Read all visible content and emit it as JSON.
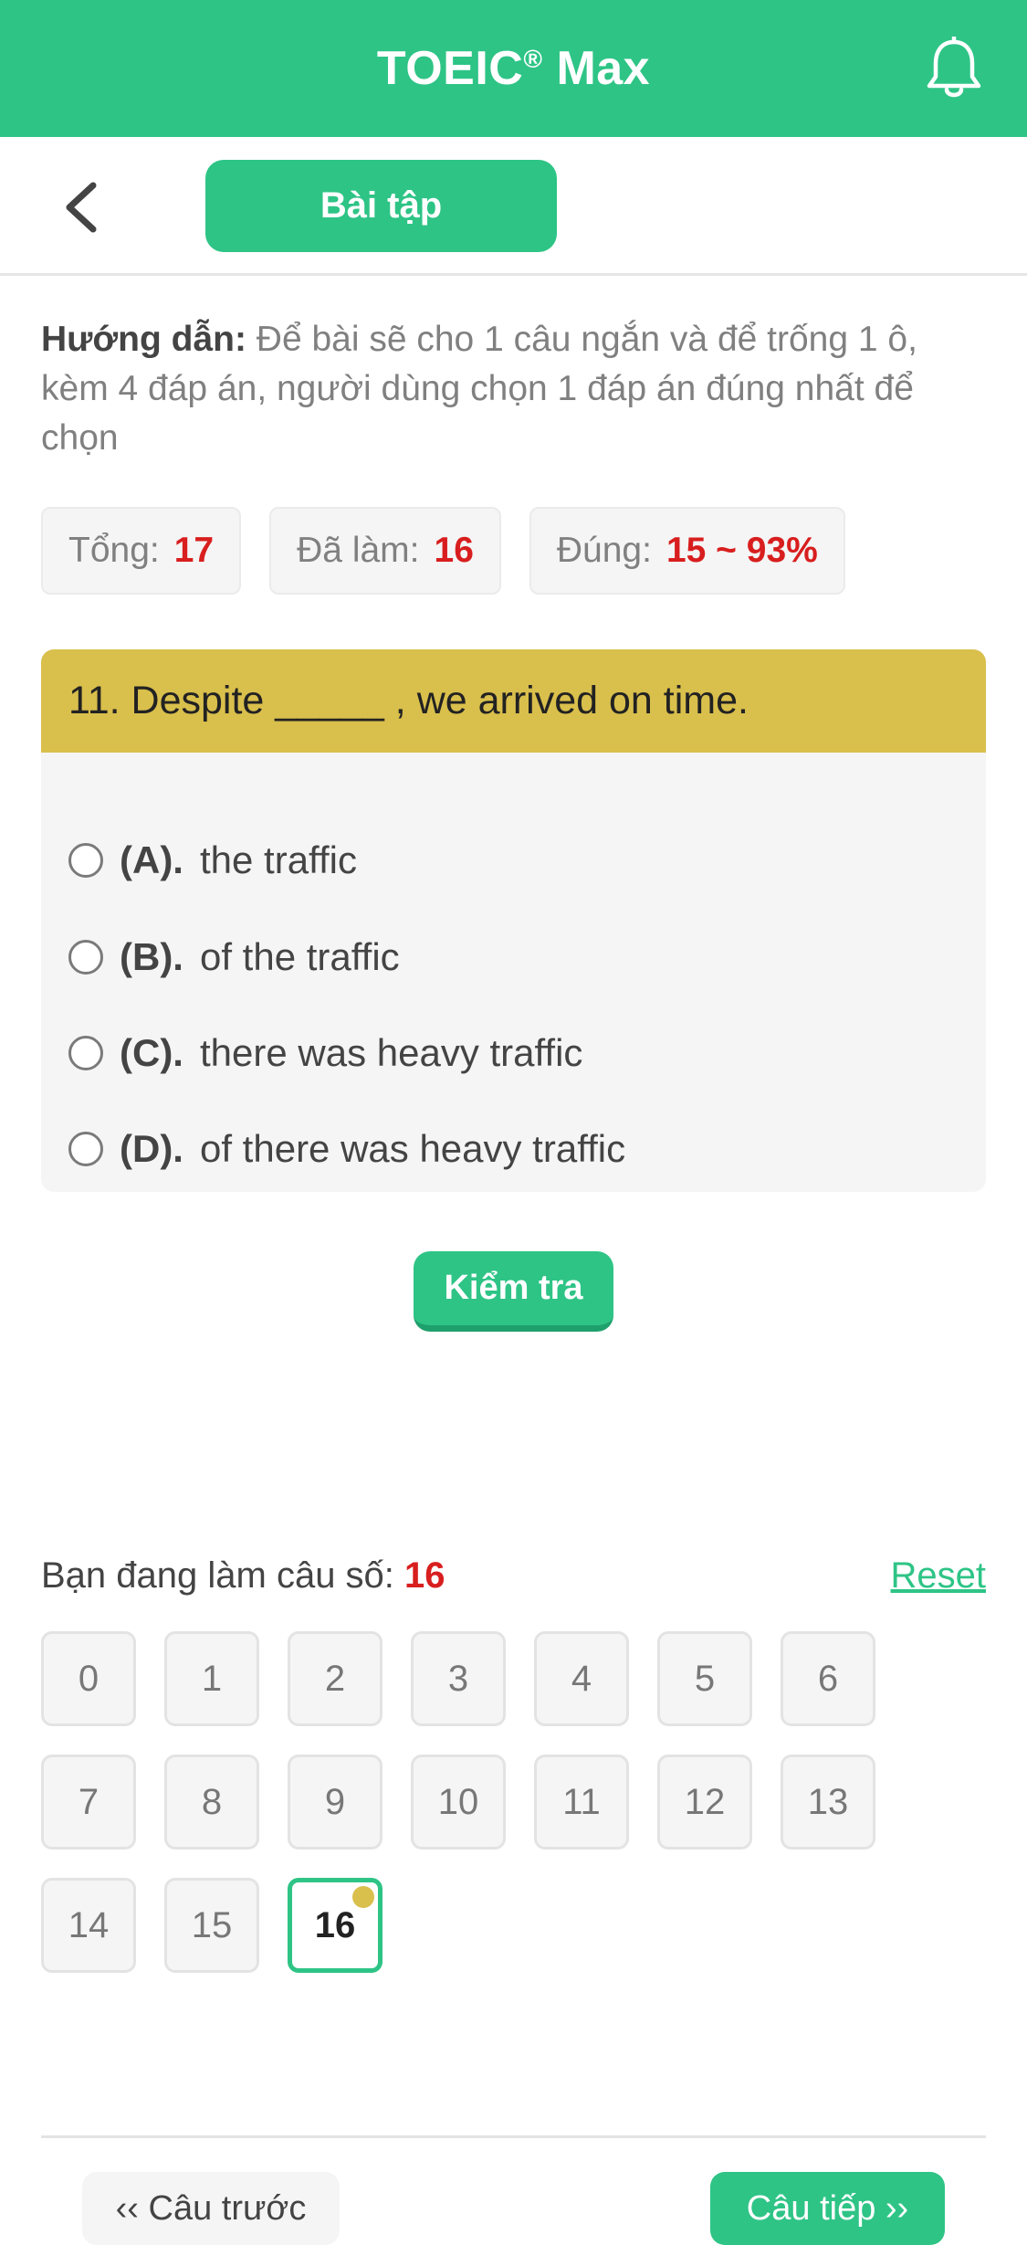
{
  "header": {
    "title_main": "TOEIC",
    "title_reg": "®",
    "title_suffix": " Max",
    "bell_icon": "bell-icon"
  },
  "subbar": {
    "back_icon": "chevron-left-icon",
    "tab_label": "Bài tập"
  },
  "guide": {
    "label": "Hướng dẫn:",
    "text": " Để bài sẽ cho 1 câu ngắn và để trống 1 ô, kèm 4 đáp án, người dùng chọn 1 đáp án đúng nhất để chọn"
  },
  "stats": [
    {
      "label": "Tổng:",
      "value": "17"
    },
    {
      "label": "Đã làm:",
      "value": "16"
    },
    {
      "label": "Đúng:",
      "value": "15 ~ 93%"
    }
  ],
  "question": {
    "text": "11. Despite _____ , we arrived on time.",
    "options": [
      {
        "label": "(A).",
        "text": "the traffic"
      },
      {
        "label": "(B).",
        "text": "of the traffic"
      },
      {
        "label": "(C).",
        "text": "there was heavy traffic"
      },
      {
        "label": "(D).",
        "text": "of there was heavy traffic"
      }
    ]
  },
  "check_button": "Kiểm tra",
  "progress": {
    "label": "Bạn đang làm câu số:",
    "current": "16",
    "reset": "Reset"
  },
  "grid": {
    "items": [
      "0",
      "1",
      "2",
      "3",
      "4",
      "5",
      "6",
      "7",
      "8",
      "9",
      "10",
      "11",
      "12",
      "13",
      "14",
      "15",
      "16"
    ],
    "active_index": 16
  },
  "nav": {
    "prev": "‹‹ Câu trước",
    "next": "Câu tiếp ››"
  },
  "colors": {
    "brand": "#2ec486",
    "question_header": "#d9bf4c",
    "highlight": "#d81e1e"
  }
}
